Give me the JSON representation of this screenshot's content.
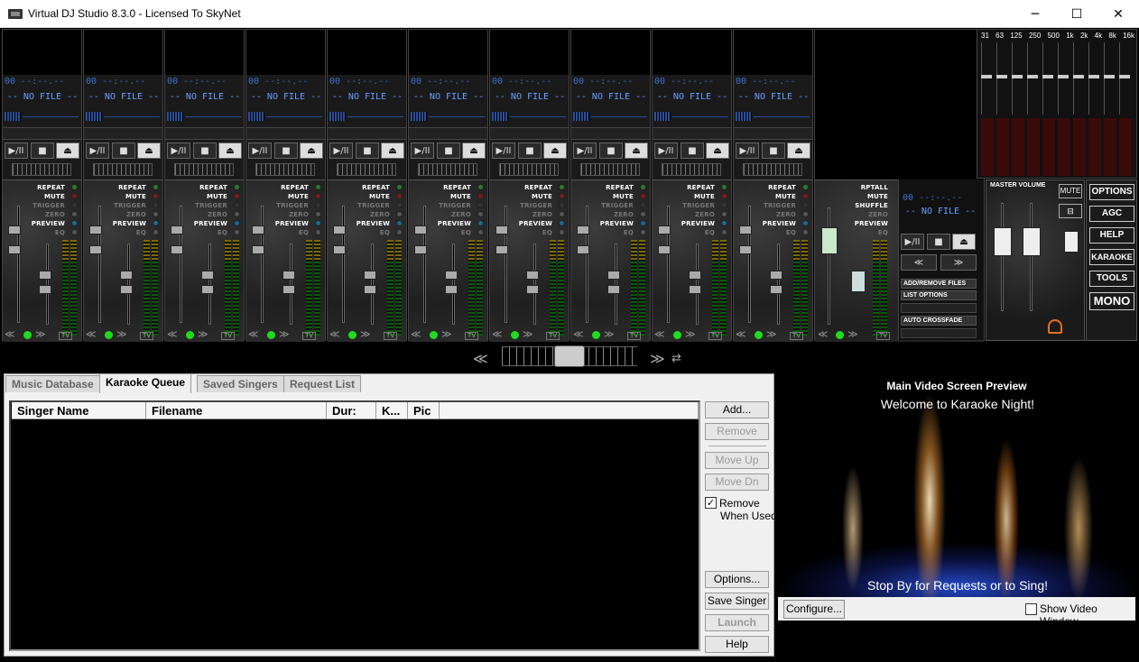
{
  "window": {
    "title": "Virtual DJ Studio 8.3.0 - Licensed To SkyNet",
    "minimize": "─",
    "maximize": "☐",
    "close": "✕"
  },
  "deck": {
    "time": "00 ‐‐:‐‐.‐‐",
    "status": "-- NO FILE --",
    "play": "▶/II",
    "stop": "■",
    "eject": "⏏",
    "opt_repeat": "REPEAT",
    "opt_mute": "MUTE",
    "opt_trigger": "TRIGGER",
    "opt_zero": "ZERO",
    "opt_preview": "PREVIEW",
    "opt_eq": "EQ",
    "tv": "TV",
    "back": "≪",
    "fwd": "≫"
  },
  "deck11": {
    "opt_rptall": "RPTALL",
    "opt_mute": "MUTE",
    "opt_shuffle": "SHUFFLE",
    "opt_zero": "ZERO",
    "opt_preview": "PREVIEW",
    "opt_eq": "EQ",
    "time": "00 ‐‐:‐‐.‐‐",
    "status": "-- NO FILE --",
    "add_remove": "ADD/REMOVE FILES",
    "list_options": "LIST OPTIONS",
    "auto_crossfade": "AUTO CROSSFADE"
  },
  "eq": {
    "bands": [
      "31",
      "63",
      "125",
      "250",
      "500",
      "1k",
      "2k",
      "4k",
      "8k",
      "16k"
    ]
  },
  "master": {
    "label": "MASTER VOLUME",
    "mute": "MUTE",
    "options": "OPTIONS",
    "agc": "AGC",
    "help": "HELP",
    "karaoke": "KARAOKE",
    "tools": "TOOLS",
    "mono": "MONO"
  },
  "crossfader": {
    "left": "≪",
    "right": "≫",
    "swap": "⇄"
  },
  "tabs": [
    "Music Database",
    "Karaoke Queue",
    "Saved Singers",
    "Request List"
  ],
  "columns": [
    "Singer Name",
    "Filename",
    "Dur:",
    "K...",
    "Pic"
  ],
  "side_buttons": {
    "add": "Add...",
    "remove": "Remove",
    "move_up": "Move Up",
    "move_dn": "Move Dn",
    "remove_when_used_1": "Remove",
    "remove_when_used_2": "When Used",
    "check": "✓",
    "options": "Options...",
    "save_singer": "Save Singer",
    "launch": "Launch",
    "help": "Help"
  },
  "video": {
    "title": "Main Video Screen Preview",
    "line1": "Welcome to Karaoke Night!",
    "line2": "Stop By for Requests or to Sing!",
    "configure": "Configure...",
    "show_window": "Show Video Window"
  }
}
